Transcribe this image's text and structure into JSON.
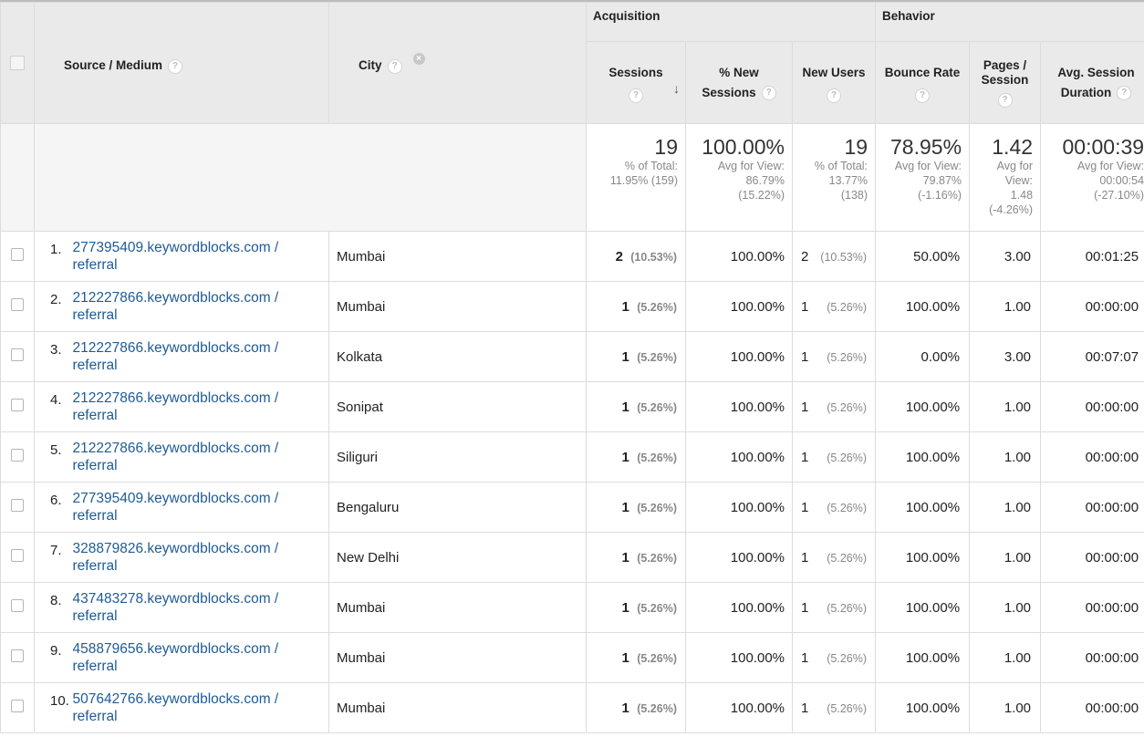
{
  "header": {
    "groups": {
      "acquisition": "Acquisition",
      "behavior": "Behavior"
    },
    "columns": {
      "source_medium": "Source / Medium",
      "city": "City",
      "sessions": "Sessions",
      "pct_new_sessions_line1": "% New",
      "pct_new_sessions_line2": "Sessions",
      "new_users": "New Users",
      "bounce_rate": "Bounce Rate",
      "pages_session_line1": "Pages /",
      "pages_session_line2": "Session",
      "avg_session_line1": "Avg. Session",
      "avg_session_line2": "Duration"
    },
    "help_glyph": "?",
    "remove_glyph": "×",
    "sort_glyph": "↓"
  },
  "totals": {
    "sessions": {
      "value": "19",
      "sub1": "% of Total:",
      "sub2": "11.95% (159)"
    },
    "pct_new_sessions": {
      "value": "100.00%",
      "sub1": "Avg for View:",
      "sub2": "86.79%",
      "sub3": "(15.22%)"
    },
    "new_users": {
      "value": "19",
      "sub1": "% of Total:",
      "sub2": "13.77%",
      "sub3": "(138)"
    },
    "bounce_rate": {
      "value": "78.95%",
      "sub1": "Avg for View:",
      "sub2": "79.87%",
      "sub3": "(-1.16%)"
    },
    "pages_session": {
      "value": "1.42",
      "sub1": "Avg for",
      "sub2": "View:",
      "sub3": "1.48",
      "sub4": "(-4.26%)"
    },
    "avg_session": {
      "value": "00:00:39",
      "sub1": "Avg for View:",
      "sub2": "00:00:54",
      "sub3": "(-27.10%)"
    }
  },
  "rows": [
    {
      "idx": "1.",
      "src1": "277395409.keywordblocks.com /",
      "src2": "referral",
      "city": "Mumbai",
      "sessions": "2",
      "sessions_pct": "(10.53%)",
      "pct_new": "100.00%",
      "new_users": "2",
      "new_users_pct": "(10.53%)",
      "bounce": "50.00%",
      "pages": "3.00",
      "duration": "00:01:25"
    },
    {
      "idx": "2.",
      "src1": "212227866.keywordblocks.com /",
      "src2": "referral",
      "city": "Mumbai",
      "sessions": "1",
      "sessions_pct": "(5.26%)",
      "pct_new": "100.00%",
      "new_users": "1",
      "new_users_pct": "(5.26%)",
      "bounce": "100.00%",
      "pages": "1.00",
      "duration": "00:00:00"
    },
    {
      "idx": "3.",
      "src1": "212227866.keywordblocks.com /",
      "src2": "referral",
      "city": "Kolkata",
      "sessions": "1",
      "sessions_pct": "(5.26%)",
      "pct_new": "100.00%",
      "new_users": "1",
      "new_users_pct": "(5.26%)",
      "bounce": "0.00%",
      "pages": "3.00",
      "duration": "00:07:07"
    },
    {
      "idx": "4.",
      "src1": "212227866.keywordblocks.com /",
      "src2": "referral",
      "city": "Sonipat",
      "sessions": "1",
      "sessions_pct": "(5.26%)",
      "pct_new": "100.00%",
      "new_users": "1",
      "new_users_pct": "(5.26%)",
      "bounce": "100.00%",
      "pages": "1.00",
      "duration": "00:00:00"
    },
    {
      "idx": "5.",
      "src1": "212227866.keywordblocks.com /",
      "src2": "referral",
      "city": "Siliguri",
      "sessions": "1",
      "sessions_pct": "(5.26%)",
      "pct_new": "100.00%",
      "new_users": "1",
      "new_users_pct": "(5.26%)",
      "bounce": "100.00%",
      "pages": "1.00",
      "duration": "00:00:00"
    },
    {
      "idx": "6.",
      "src1": "277395409.keywordblocks.com /",
      "src2": "referral",
      "city": "Bengaluru",
      "sessions": "1",
      "sessions_pct": "(5.26%)",
      "pct_new": "100.00%",
      "new_users": "1",
      "new_users_pct": "(5.26%)",
      "bounce": "100.00%",
      "pages": "1.00",
      "duration": "00:00:00"
    },
    {
      "idx": "7.",
      "src1": "328879826.keywordblocks.com /",
      "src2": "referral",
      "city": "New Delhi",
      "sessions": "1",
      "sessions_pct": "(5.26%)",
      "pct_new": "100.00%",
      "new_users": "1",
      "new_users_pct": "(5.26%)",
      "bounce": "100.00%",
      "pages": "1.00",
      "duration": "00:00:00"
    },
    {
      "idx": "8.",
      "src1": "437483278.keywordblocks.com /",
      "src2": "referral",
      "city": "Mumbai",
      "sessions": "1",
      "sessions_pct": "(5.26%)",
      "pct_new": "100.00%",
      "new_users": "1",
      "new_users_pct": "(5.26%)",
      "bounce": "100.00%",
      "pages": "1.00",
      "duration": "00:00:00"
    },
    {
      "idx": "9.",
      "src1": "458879656.keywordblocks.com /",
      "src2": "referral",
      "city": "Mumbai",
      "sessions": "1",
      "sessions_pct": "(5.26%)",
      "pct_new": "100.00%",
      "new_users": "1",
      "new_users_pct": "(5.26%)",
      "bounce": "100.00%",
      "pages": "1.00",
      "duration": "00:00:00"
    },
    {
      "idx": "10.",
      "src1": "507642766.keywordblocks.com /",
      "src2": "referral",
      "city": "Mumbai",
      "sessions": "1",
      "sessions_pct": "(5.26%)",
      "pct_new": "100.00%",
      "new_users": "1",
      "new_users_pct": "(5.26%)",
      "bounce": "100.00%",
      "pages": "1.00",
      "duration": "00:00:00"
    }
  ]
}
